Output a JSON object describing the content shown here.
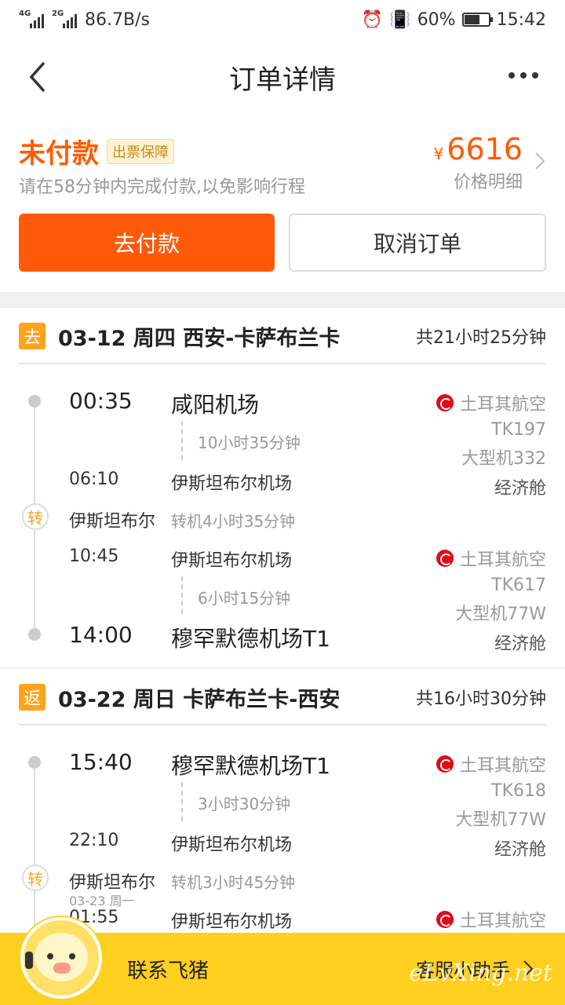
{
  "status_bar": {
    "network_1": "4G",
    "network_2": "2G",
    "speed": "86.7B/s",
    "battery": "60%",
    "time": "15:42"
  },
  "nav": {
    "title": "订单详情",
    "back_icon": "chevron-left-icon",
    "more_icon": "more-dots-icon"
  },
  "order": {
    "status": "未付款",
    "guarantee": "出票保障",
    "tip": "请在58分钟内完成付款,以免影响行程",
    "currency": "¥",
    "price": "6616",
    "price_detail": "价格明细",
    "pay_button": "去付款",
    "cancel_button": "取消订单"
  },
  "outbound": {
    "badge": "去",
    "route": "03-12 周四 西安-卡萨布兰卡",
    "total": "共21小时25分钟",
    "seg1": {
      "dep_time": "00:35",
      "dep_airport": "咸阳机场",
      "duration": "10小时35分钟",
      "arr_time": "06:10",
      "arr_airport": "伊斯坦布尔机场",
      "airline": "土耳其航空",
      "flight": "TK197",
      "aircraft": "大型机332",
      "cabin": "经济舱"
    },
    "transfer": {
      "icon": "转",
      "city": "伊斯坦布尔",
      "info": "转机4小时35分钟"
    },
    "seg2": {
      "dep_time": "10:45",
      "dep_airport": "伊斯坦布尔机场",
      "duration": "6小时15分钟",
      "arr_time": "14:00",
      "arr_airport": "穆罕默德机场T1",
      "airline": "土耳其航空",
      "flight": "TK617",
      "aircraft": "大型机77W",
      "cabin": "经济舱"
    }
  },
  "return": {
    "badge": "返",
    "route": "03-22 周日 卡萨布兰卡-西安",
    "total": "共16小时30分钟",
    "seg1": {
      "dep_time": "15:40",
      "dep_airport": "穆罕默德机场T1",
      "duration": "3小时30分钟",
      "arr_time": "22:10",
      "arr_airport": "伊斯坦布尔机场",
      "airline": "土耳其航空",
      "flight": "TK618",
      "aircraft": "大型机77W",
      "cabin": "经济舱"
    },
    "transfer": {
      "icon": "转",
      "city": "伊斯坦布尔",
      "info": "转机3小时45分钟",
      "next_day": "03-23 周一"
    },
    "seg2": {
      "dep_time": "01:55",
      "dep_airport": "伊斯坦布尔机场",
      "airline": "土耳其航空"
    }
  },
  "footer": {
    "contact": "联系飞猪",
    "helper": "客服小助手",
    "watermark": "eLvXing.net"
  },
  "colors": {
    "accent": "#ff5a00",
    "badge": "#ffa31a",
    "footer": "#ffcf1f"
  }
}
